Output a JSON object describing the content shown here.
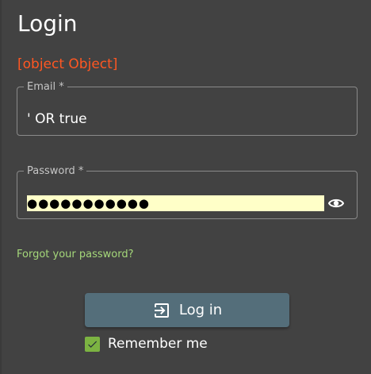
{
  "login_form": {
    "title": "Login",
    "error_message": "[object Object]",
    "email": {
      "label": "Email *",
      "value": "' OR true"
    },
    "password": {
      "label": "Password *",
      "masked_value": "●●●●●●●●●●●",
      "toggle_icon": "eye-icon"
    },
    "forgot_password_link": "Forgot your password?",
    "login_button": {
      "label": "Log in",
      "icon": "login-icon"
    },
    "remember_me": {
      "label": "Remember me",
      "checked": true
    }
  },
  "colors": {
    "background": "#424242",
    "error": "#ff5722",
    "link": "#a5d87a",
    "button": "#546e7a",
    "checkbox": "#7cb342",
    "autofill": "#ffffc8"
  }
}
